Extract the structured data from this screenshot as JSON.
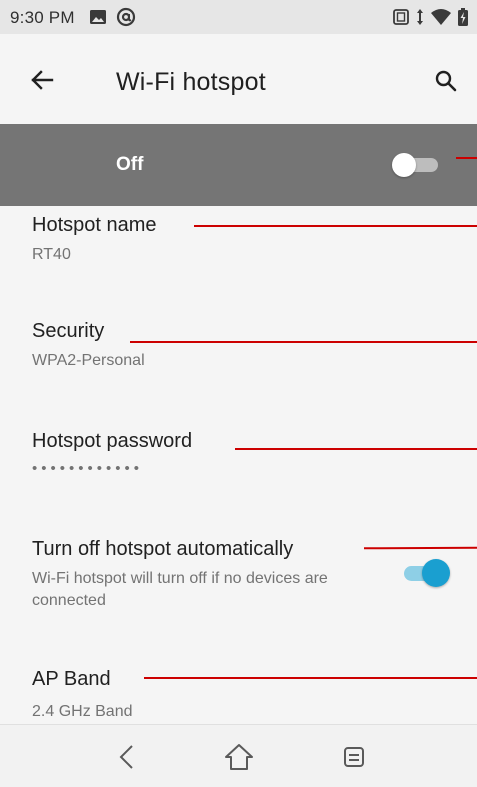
{
  "status_bar": {
    "time": "9:30 PM",
    "icons": [
      "image-icon",
      "at-sign-icon",
      "vibrate-icon",
      "data-arrows-icon",
      "wifi-icon",
      "battery-charging-icon"
    ]
  },
  "app_bar": {
    "title": "Wi-Fi hotspot",
    "icons": [
      "back-arrow-icon",
      "search-icon"
    ]
  },
  "master_switch": {
    "label": "Off",
    "checked": false
  },
  "preferences": [
    {
      "title": "Hotspot name",
      "summary": "RT40"
    },
    {
      "title": "Security",
      "summary": "WPA2-Personal"
    },
    {
      "title": "Hotspot password",
      "summary": "••••••••••••"
    },
    {
      "title": "Turn off hotspot automatically",
      "summary": "Wi-Fi hotspot will turn off if no devices are connected",
      "checked": true
    },
    {
      "title": "AP Band",
      "summary": "2.4 GHz Band"
    }
  ],
  "nav_bar": {
    "icons": [
      "nav-back-icon",
      "nav-home-icon",
      "nav-recents-icon"
    ]
  },
  "colors": {
    "accent": "#1a9fd0",
    "master_bar": "#757575",
    "annotation": "#cc0000"
  }
}
